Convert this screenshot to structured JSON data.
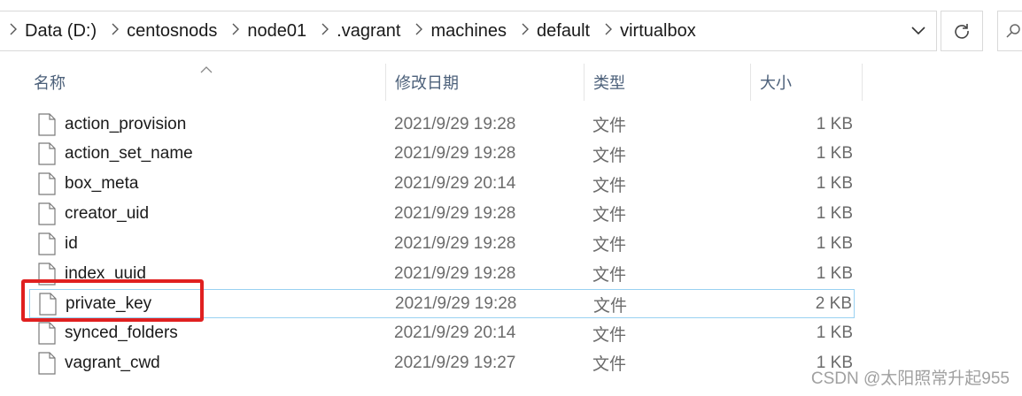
{
  "breadcrumb": [
    "Data (D:)",
    "centosnods",
    "node01",
    ".vagrant",
    "machines",
    "default",
    "virtualbox"
  ],
  "columns": {
    "name": "名称",
    "date": "修改日期",
    "type": "类型",
    "size": "大小"
  },
  "files": [
    {
      "name": "action_provision",
      "date": "2021/9/29 19:28",
      "type": "文件",
      "size": "1 KB"
    },
    {
      "name": "action_set_name",
      "date": "2021/9/29 19:28",
      "type": "文件",
      "size": "1 KB"
    },
    {
      "name": "box_meta",
      "date": "2021/9/29 20:14",
      "type": "文件",
      "size": "1 KB"
    },
    {
      "name": "creator_uid",
      "date": "2021/9/29 19:28",
      "type": "文件",
      "size": "1 KB"
    },
    {
      "name": "id",
      "date": "2021/9/29 19:28",
      "type": "文件",
      "size": "1 KB"
    },
    {
      "name": "index_uuid",
      "date": "2021/9/29 19:28",
      "type": "文件",
      "size": "1 KB"
    },
    {
      "name": "private_key",
      "date": "2021/9/29 19:28",
      "type": "文件",
      "size": "2 KB",
      "selected": true
    },
    {
      "name": "synced_folders",
      "date": "2021/9/29 20:14",
      "type": "文件",
      "size": "1 KB"
    },
    {
      "name": "vagrant_cwd",
      "date": "2021/9/29 19:27",
      "type": "文件",
      "size": "1 KB"
    }
  ],
  "watermark": "CSDN @太阳照常升起955",
  "colors": {
    "highlight": "#e02020",
    "selection_border": "#99d1f2",
    "header_text": "#4c607a"
  },
  "icons": [
    "chevron-right-icon",
    "chevron-down-icon",
    "refresh-icon",
    "search-icon",
    "sort-up-icon",
    "file-icon"
  ]
}
